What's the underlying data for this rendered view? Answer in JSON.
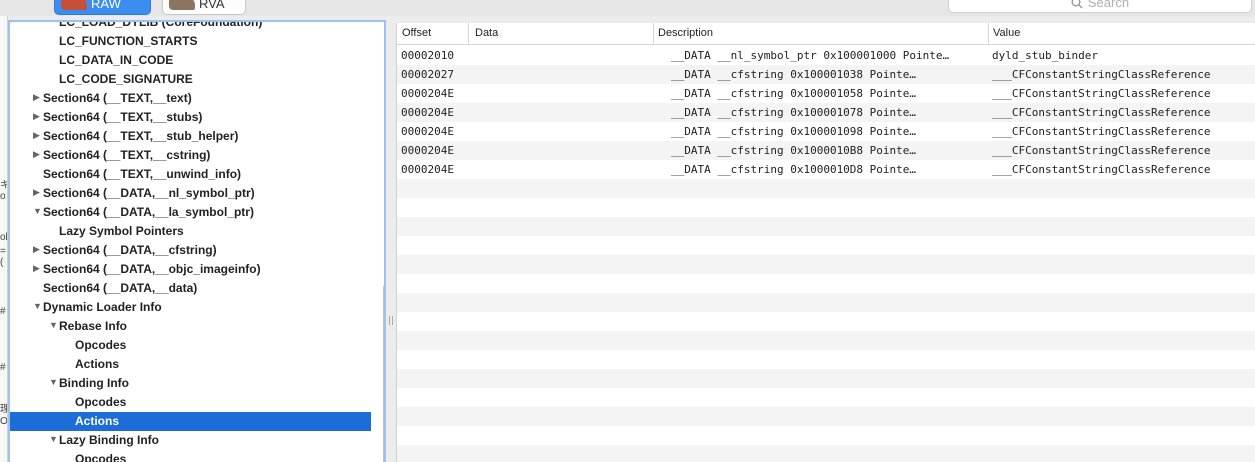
{
  "toolbar": {
    "segments": [
      {
        "label": "RAW",
        "selected": true,
        "icon": "raw-icon"
      },
      {
        "label": "RVA",
        "selected": false,
        "icon": "rva-icon"
      }
    ],
    "search": {
      "placeholder": "Search",
      "icon": "search-icon"
    }
  },
  "outline": {
    "items": [
      {
        "label": "LC_LOAD_DYLIB (CoreFoundation)",
        "indent": 2,
        "expander": "none"
      },
      {
        "label": "LC_FUNCTION_STARTS",
        "indent": 2,
        "expander": "none"
      },
      {
        "label": "LC_DATA_IN_CODE",
        "indent": 2,
        "expander": "none"
      },
      {
        "label": "LC_CODE_SIGNATURE",
        "indent": 2,
        "expander": "none"
      },
      {
        "label": "Section64 (__TEXT,__text)",
        "indent": 1,
        "expander": "collapsed"
      },
      {
        "label": "Section64 (__TEXT,__stubs)",
        "indent": 1,
        "expander": "collapsed"
      },
      {
        "label": "Section64 (__TEXT,__stub_helper)",
        "indent": 1,
        "expander": "collapsed"
      },
      {
        "label": "Section64 (__TEXT,__cstring)",
        "indent": 1,
        "expander": "collapsed"
      },
      {
        "label": "Section64 (__TEXT,__unwind_info)",
        "indent": 1,
        "expander": "none"
      },
      {
        "label": "Section64 (__DATA,__nl_symbol_ptr)",
        "indent": 1,
        "expander": "collapsed"
      },
      {
        "label": "Section64 (__DATA,__la_symbol_ptr)",
        "indent": 1,
        "expander": "expanded"
      },
      {
        "label": "Lazy Symbol Pointers",
        "indent": 2,
        "expander": "none"
      },
      {
        "label": "Section64 (__DATA,__cfstring)",
        "indent": 1,
        "expander": "collapsed"
      },
      {
        "label": "Section64 (__DATA,__objc_imageinfo)",
        "indent": 1,
        "expander": "collapsed"
      },
      {
        "label": "Section64 (__DATA,__data)",
        "indent": 1,
        "expander": "none"
      },
      {
        "label": "Dynamic Loader Info",
        "indent": 1,
        "expander": "expanded"
      },
      {
        "label": "Rebase Info",
        "indent": 2,
        "expander": "expanded"
      },
      {
        "label": "Opcodes",
        "indent": 3,
        "expander": "none"
      },
      {
        "label": "Actions",
        "indent": 3,
        "expander": "none"
      },
      {
        "label": "Binding Info",
        "indent": 2,
        "expander": "expanded"
      },
      {
        "label": "Opcodes",
        "indent": 3,
        "expander": "none"
      },
      {
        "label": "Actions",
        "indent": 3,
        "expander": "none",
        "selected": true
      },
      {
        "label": "Lazy Binding Info",
        "indent": 2,
        "expander": "expanded"
      },
      {
        "label": "Opcodes",
        "indent": 3,
        "expander": "none"
      }
    ]
  },
  "table": {
    "columns": [
      "Offset",
      "Data",
      "Description",
      "Value"
    ],
    "rows": [
      {
        "offset": "00002010",
        "data": "",
        "description": "__DATA __nl_symbol_ptr  0x100001000 Pointe…",
        "value": "dyld_stub_binder"
      },
      {
        "offset": "00002027",
        "data": "",
        "description": "__DATA __cfstring       0x100001038 Pointe…",
        "value": "___CFConstantStringClassReference"
      },
      {
        "offset": "0000204E",
        "data": "",
        "description": "__DATA __cfstring       0x100001058 Pointe…",
        "value": "___CFConstantStringClassReference"
      },
      {
        "offset": "0000204E",
        "data": "",
        "description": "__DATA __cfstring       0x100001078 Pointe…",
        "value": "___CFConstantStringClassReference"
      },
      {
        "offset": "0000204E",
        "data": "",
        "description": "__DATA __cfstring       0x100001098 Pointe…",
        "value": "___CFConstantStringClassReference"
      },
      {
        "offset": "0000204E",
        "data": "",
        "description": "__DATA __cfstring       0x1000010B8 Pointe…",
        "value": "___CFConstantStringClassReference"
      },
      {
        "offset": "0000204E",
        "data": "",
        "description": "__DATA __cfstring       0x1000010D8 Pointe…",
        "value": "___CFConstantStringClassReference"
      }
    ]
  },
  "background_window": {
    "glyphs": [
      "キ",
      "o",
      "ok",
      "=(",
      "#",
      "#",
      "理",
      "O"
    ]
  },
  "colors": {
    "selection": "#1c6dd8",
    "segment_selected": "#3b8ef0",
    "focus_ring": "#9cc3f0",
    "alt_row": "#f4f4f4"
  }
}
